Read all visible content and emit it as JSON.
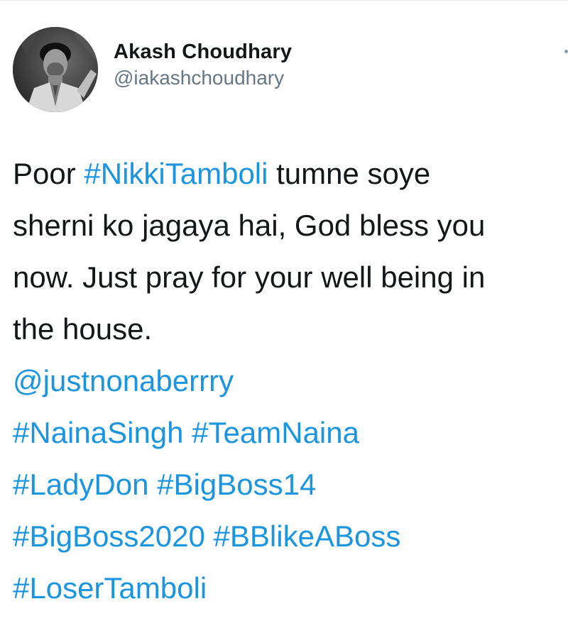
{
  "author": {
    "display_name": "Akash Choudhary",
    "handle": "@iakashchoudhary"
  },
  "tweet": {
    "lines": [
      [
        {
          "text": "Poor ",
          "link": false
        },
        {
          "text": "#NikkiTamboli",
          "link": true
        },
        {
          "text": " tumne soye",
          "link": false
        }
      ],
      [
        {
          "text": "sherni ko jagaya hai, God bless you",
          "link": false
        }
      ],
      [
        {
          "text": "now. Just pray for your well being in",
          "link": false
        }
      ],
      [
        {
          "text": "the house.",
          "link": false
        }
      ],
      [
        {
          "text": "@justnonaberrry",
          "link": true
        }
      ],
      [
        {
          "text": "#NainaSingh #TeamNaina",
          "link": true
        }
      ],
      [
        {
          "text": "#LadyDon #BigBoss14",
          "link": true
        }
      ],
      [
        {
          "text": "#BigBoss2020 #BBlikeABoss",
          "link": true
        }
      ],
      [
        {
          "text": "#LoserTamboli",
          "link": true
        }
      ]
    ]
  },
  "colors": {
    "text": "#14171a",
    "link": "#1b95e0",
    "secondary": "#657786"
  },
  "icons": {
    "avatar": "profile-photo",
    "more": "more-options-icon"
  }
}
